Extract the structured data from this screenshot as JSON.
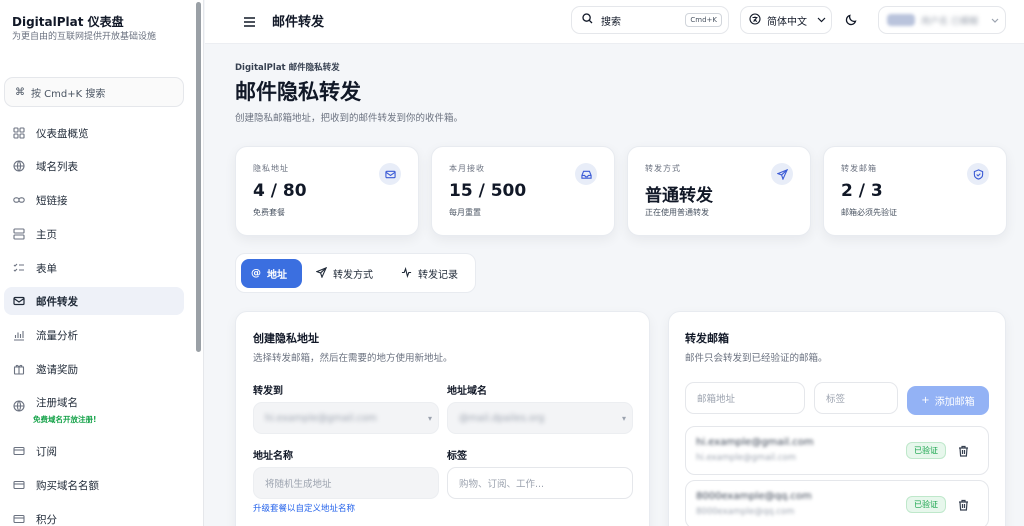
{
  "brand": {
    "title": "DigitalPlat 仪表盘",
    "subtitle": "为更自由的互联网提供开放基础设施"
  },
  "sidebar": {
    "search_label": "按 Cmd+K 搜索",
    "items": [
      {
        "label": "仪表盘概览",
        "icon": "grid-icon"
      },
      {
        "label": "域名列表",
        "icon": "globe-icon"
      },
      {
        "label": "短链接",
        "icon": "link-icon"
      },
      {
        "label": "主页",
        "icon": "layout-icon"
      },
      {
        "label": "表单",
        "icon": "list-check-icon"
      },
      {
        "label": "邮件转发",
        "icon": "mail-icon"
      },
      {
        "label": "流量分析",
        "icon": "chart-icon"
      },
      {
        "label": "邀请奖励",
        "icon": "gift-icon"
      },
      {
        "label": "注册域名",
        "icon": "globe-icon"
      },
      {
        "label": "订阅",
        "icon": "card-icon"
      },
      {
        "label": "购买域名名额",
        "icon": "card-icon"
      },
      {
        "label": "积分",
        "icon": "card-icon"
      }
    ],
    "register_sub": "免费域名开放注册!"
  },
  "header": {
    "title": "邮件转发",
    "search_label": "搜索",
    "search_kbd": "Cmd+K",
    "language": "简体中文",
    "user_name": "用户名 已模糊"
  },
  "page": {
    "breadcrumb": "DigitalPlat 邮件隐私转发",
    "title": "邮件隐私转发",
    "description": "创建隐私邮箱地址，把收到的邮件转发到你的收件箱。"
  },
  "stats": [
    {
      "label": "隐私地址",
      "value": "4 / 80",
      "sub": "免费套餐",
      "icon": "mail-icon"
    },
    {
      "label": "本月接收",
      "value": "15 / 500",
      "sub": "每月重置",
      "icon": "inbox-icon"
    },
    {
      "label": "转发方式",
      "value": "普通转发",
      "sub": "正在使用普通转发",
      "icon": "send-icon"
    },
    {
      "label": "转发邮箱",
      "value": "2 / 3",
      "sub": "邮箱必须先验证",
      "icon": "shield-icon"
    }
  ],
  "tabs": [
    {
      "label": "地址",
      "icon": "at-icon",
      "active": true
    },
    {
      "label": "转发方式",
      "icon": "send-icon",
      "active": false
    },
    {
      "label": "转发记录",
      "icon": "activity-icon",
      "active": false
    }
  ],
  "create_card": {
    "title": "创建隐私地址",
    "description": "选择转发邮箱，然后在需要的地方使用新地址。",
    "forward_to_label": "转发到",
    "forward_to_value": "hi.example@gmail.com",
    "domain_label": "地址域名",
    "domain_value": "@mail.dpailes.org",
    "name_label": "地址名称",
    "name_placeholder": "将随机生成地址",
    "tag_label": "标签",
    "tag_placeholder": "购物、订阅、工作...",
    "upgrade_link": "升级套餐以自定义地址名称"
  },
  "forward_card": {
    "title": "转发邮箱",
    "description": "邮件只会转发到已经验证的邮箱。",
    "email_placeholder": "邮箱地址",
    "tag_placeholder": "标签",
    "add_button": "添加邮箱",
    "emails": [
      {
        "address": "hi.example@gmail.com",
        "sub": "hi.example@gmail.com",
        "status": "已验证"
      },
      {
        "address": "8000example@qq.com",
        "sub": "8000example@qq.com",
        "status": "已验证"
      }
    ]
  },
  "colors": {
    "accent": "#3b6fe0",
    "accent_light": "#93b2f5",
    "verified": "#16a34a",
    "background": "#f4f6f9"
  }
}
